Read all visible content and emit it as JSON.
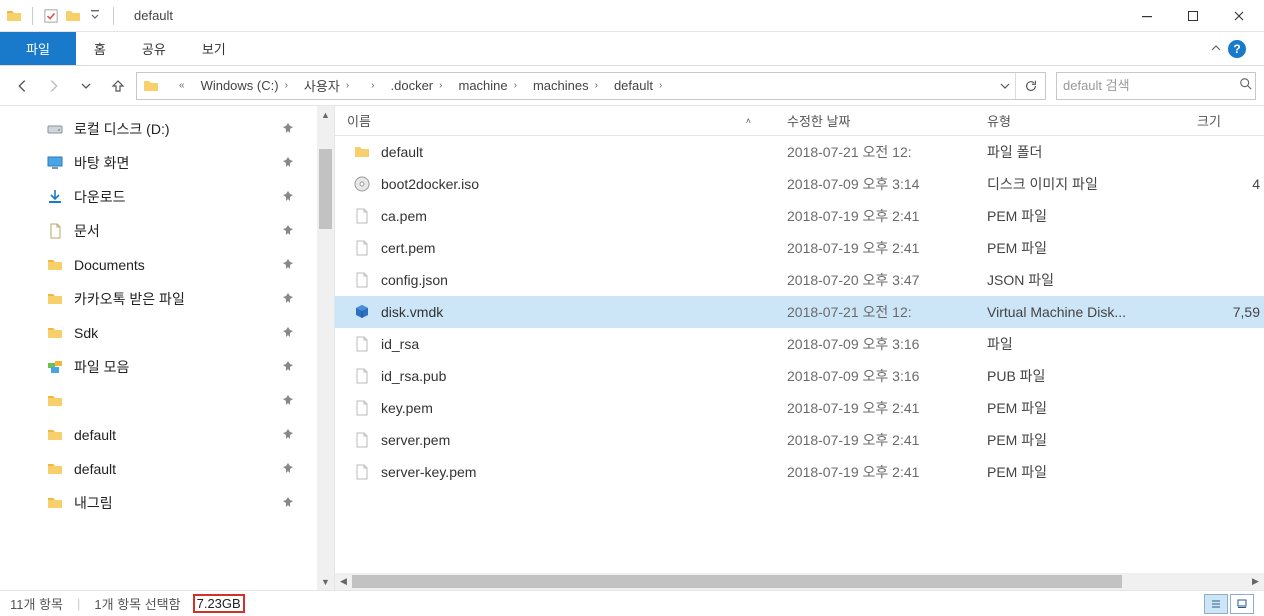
{
  "title": "default",
  "ribbon": {
    "file": "파일",
    "home": "홈",
    "share": "공유",
    "view": "보기"
  },
  "breadcrumbs": [
    {
      "label": "Windows (C:)"
    },
    {
      "label": "사용자"
    },
    {
      "label": ""
    },
    {
      "label": ".docker"
    },
    {
      "label": "machine"
    },
    {
      "label": "machines"
    },
    {
      "label": "default"
    }
  ],
  "search": {
    "placeholder": "default 검색"
  },
  "nav_items": [
    {
      "label": "로컬 디스크 (D:)",
      "icon": "drive"
    },
    {
      "label": "바탕 화면",
      "icon": "desktop"
    },
    {
      "label": "다운로드",
      "icon": "download"
    },
    {
      "label": "문서",
      "icon": "document"
    },
    {
      "label": "Documents",
      "icon": "folder"
    },
    {
      "label": "카카오톡 받은 파일",
      "icon": "folder"
    },
    {
      "label": "Sdk",
      "icon": "folder"
    },
    {
      "label": "파일 모음",
      "icon": "collection"
    },
    {
      "label": "",
      "icon": "folder"
    },
    {
      "label": "default",
      "icon": "folder"
    },
    {
      "label": "default",
      "icon": "folder"
    },
    {
      "label": "내그림",
      "icon": "folder"
    }
  ],
  "columns": {
    "name": "이름",
    "date": "수정한 날짜",
    "type": "유형",
    "size": "크기"
  },
  "rows": [
    {
      "name": "default",
      "date": "2018-07-21 오전 12:",
      "type": "파일 폴더",
      "size": "",
      "icon": "folder",
      "selected": false
    },
    {
      "name": "boot2docker.iso",
      "date": "2018-07-09 오후 3:14",
      "type": "디스크 이미지 파일",
      "size": "4",
      "icon": "disc",
      "selected": false
    },
    {
      "name": "ca.pem",
      "date": "2018-07-19 오후 2:41",
      "type": "PEM 파일",
      "size": "",
      "icon": "file",
      "selected": false
    },
    {
      "name": "cert.pem",
      "date": "2018-07-19 오후 2:41",
      "type": "PEM 파일",
      "size": "",
      "icon": "file",
      "selected": false
    },
    {
      "name": "config.json",
      "date": "2018-07-20 오후 3:47",
      "type": "JSON 파일",
      "size": "",
      "icon": "file",
      "selected": false
    },
    {
      "name": "disk.vmdk",
      "date": "2018-07-21 오전 12:",
      "type": "Virtual Machine Disk...",
      "size": "7,59",
      "icon": "cube",
      "selected": true
    },
    {
      "name": "id_rsa",
      "date": "2018-07-09 오후 3:16",
      "type": "파일",
      "size": "",
      "icon": "file",
      "selected": false
    },
    {
      "name": "id_rsa.pub",
      "date": "2018-07-09 오후 3:16",
      "type": "PUB 파일",
      "size": "",
      "icon": "file",
      "selected": false
    },
    {
      "name": "key.pem",
      "date": "2018-07-19 오후 2:41",
      "type": "PEM 파일",
      "size": "",
      "icon": "file",
      "selected": false
    },
    {
      "name": "server.pem",
      "date": "2018-07-19 오후 2:41",
      "type": "PEM 파일",
      "size": "",
      "icon": "file",
      "selected": false
    },
    {
      "name": "server-key.pem",
      "date": "2018-07-19 오후 2:41",
      "type": "PEM 파일",
      "size": "",
      "icon": "file",
      "selected": false
    }
  ],
  "status": {
    "items": "11개 항목",
    "selected": "1개 항목 선택함",
    "size": "7.23GB"
  }
}
